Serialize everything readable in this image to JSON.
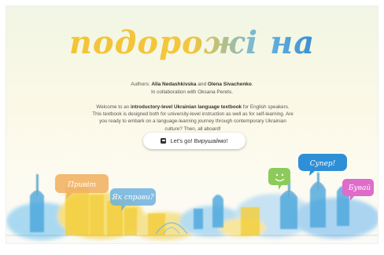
{
  "logo": {
    "text": "подорожі на"
  },
  "authors": {
    "prefix": "Authors: ",
    "name1": "Alla Nedashkivska",
    "and": " and ",
    "name2": "Olena Sivachenko",
    "suffix": ".",
    "collab_prefix": "In collaboration with ",
    "collab_name": "Oksana Perets",
    "collab_suffix": "."
  },
  "intro": {
    "part1": "Welcome to an ",
    "bold": "introductory-level Ukrainian language textbook",
    "part2": " for English speakers. This textbook is designed both for university-level instruction as well as for self-learning. Are you ready to embark on a language-learning journey through contemporary Ukrainian culture? Then, all aboard!"
  },
  "cta": {
    "label": "Let's go! Вирушаймо!",
    "icon": "book-icon"
  },
  "bubbles": {
    "pryvit": "Привіт",
    "yak_spravy": "Як справи?",
    "super": "Супер!",
    "buvai": "Бувай"
  },
  "colors": {
    "yellow": "#f2c437",
    "blue": "#5aaee0",
    "green": "#8ccb5a",
    "pink": "#e06fc8",
    "orange": "#f0b463"
  }
}
